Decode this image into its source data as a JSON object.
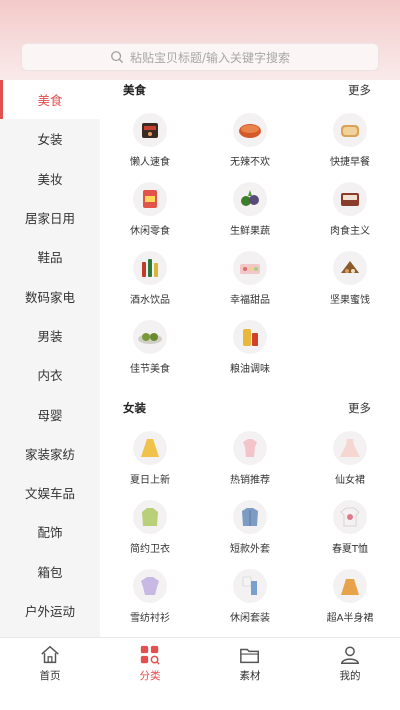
{
  "search": {
    "placeholder": "粘贴宝贝标题/输入关键字搜索",
    "icon": "search-icon"
  },
  "sidebar": {
    "active_index": 0,
    "accent_color": "#e2504f",
    "items": [
      "美食",
      "女装",
      "美妆",
      "居家日用",
      "鞋品",
      "数码家电",
      "男装",
      "内衣",
      "母婴",
      "家装家纺",
      "文娱车品",
      "配饰",
      "箱包",
      "户外运动"
    ]
  },
  "sections": [
    {
      "title": "美食",
      "more": "更多",
      "items": [
        {
          "label": "懒人速食",
          "icon": "instant-food-icon"
        },
        {
          "label": "无辣不欢",
          "icon": "spicy-food-icon"
        },
        {
          "label": "快捷早餐",
          "icon": "breakfast-bread-icon"
        },
        {
          "label": "休闲零食",
          "icon": "snack-bag-icon"
        },
        {
          "label": "生鲜果蔬",
          "icon": "fruit-vegetable-icon"
        },
        {
          "label": "肉食主义",
          "icon": "meat-snack-icon"
        },
        {
          "label": "酒水饮品",
          "icon": "drink-bottles-icon"
        },
        {
          "label": "幸福甜品",
          "icon": "dessert-icon"
        },
        {
          "label": "坚果蜜饯",
          "icon": "nuts-icon"
        },
        {
          "label": "佳节美食",
          "icon": "festival-food-icon"
        },
        {
          "label": "粮油调味",
          "icon": "oil-seasoning-icon"
        }
      ]
    },
    {
      "title": "女装",
      "more": "更多",
      "items": [
        {
          "label": "夏日上新",
          "icon": "yellow-dress-icon"
        },
        {
          "label": "热销推荐",
          "icon": "pink-top-icon"
        },
        {
          "label": "仙女裙",
          "icon": "fairy-dress-icon"
        },
        {
          "label": "简约卫衣",
          "icon": "hoodie-icon"
        },
        {
          "label": "短款外套",
          "icon": "denim-jacket-icon"
        },
        {
          "label": "春夏T恤",
          "icon": "tshirt-icon"
        },
        {
          "label": "雪纺衬衫",
          "icon": "chiffon-blouse-icon"
        },
        {
          "label": "休闲套装",
          "icon": "casual-set-icon"
        },
        {
          "label": "超A半身裙",
          "icon": "a-line-skirt-icon"
        }
      ]
    }
  ],
  "tabbar": {
    "active_index": 1,
    "items": [
      {
        "label": "首页",
        "icon": "home-icon"
      },
      {
        "label": "分类",
        "icon": "category-icon"
      },
      {
        "label": "素材",
        "icon": "folder-icon"
      },
      {
        "label": "我的",
        "icon": "user-icon"
      }
    ]
  }
}
